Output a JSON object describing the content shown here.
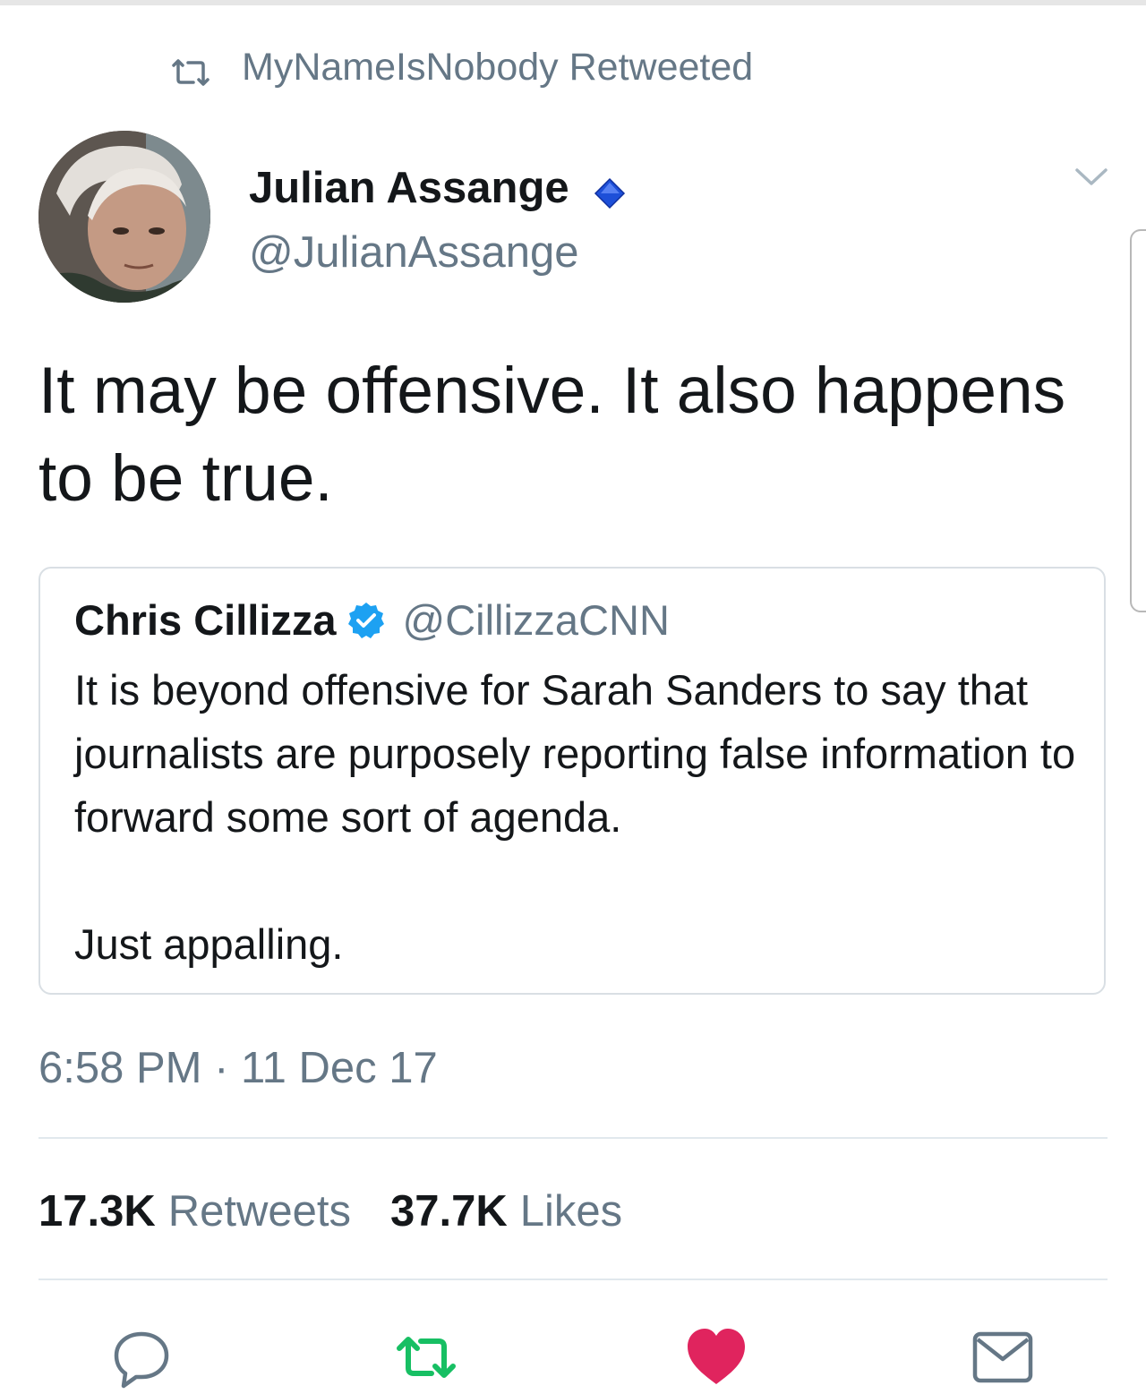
{
  "retweet_context": {
    "icon": "retweet-icon",
    "text": "MyNameIsNobody Retweeted"
  },
  "author": {
    "name": "Julian Assange",
    "handle": "@JulianAssange",
    "badge_icon": "diamond-icon",
    "badge_color": "#1d4fd8"
  },
  "tweet": {
    "text": "It may be offensive. It also happens to be true."
  },
  "quoted_tweet": {
    "name": "Chris Cillizza",
    "handle": "@CillizzaCNN",
    "verified_icon": "verified-badge-icon",
    "paragraph_1": "It is beyond offensive for Sarah Sanders to say that journalists are purposely reporting false information to forward some sort of agenda.",
    "paragraph_2": "Just appalling."
  },
  "timestamp": "6:58 PM · 11 Dec 17",
  "stats": {
    "retweets_count": "17.3K",
    "retweets_label": "Retweets",
    "likes_count": "37.7K",
    "likes_label": "Likes"
  },
  "actions": {
    "reply_icon": "reply-icon",
    "retweet_icon": "retweet-icon",
    "like_icon": "heart-icon",
    "dm_icon": "mail-icon"
  },
  "colors": {
    "secondary_text": "#657786",
    "primary_text": "#14171a",
    "retweet_active": "#17bf63",
    "like_active": "#e0245e",
    "verified_blue": "#1da1f2"
  }
}
